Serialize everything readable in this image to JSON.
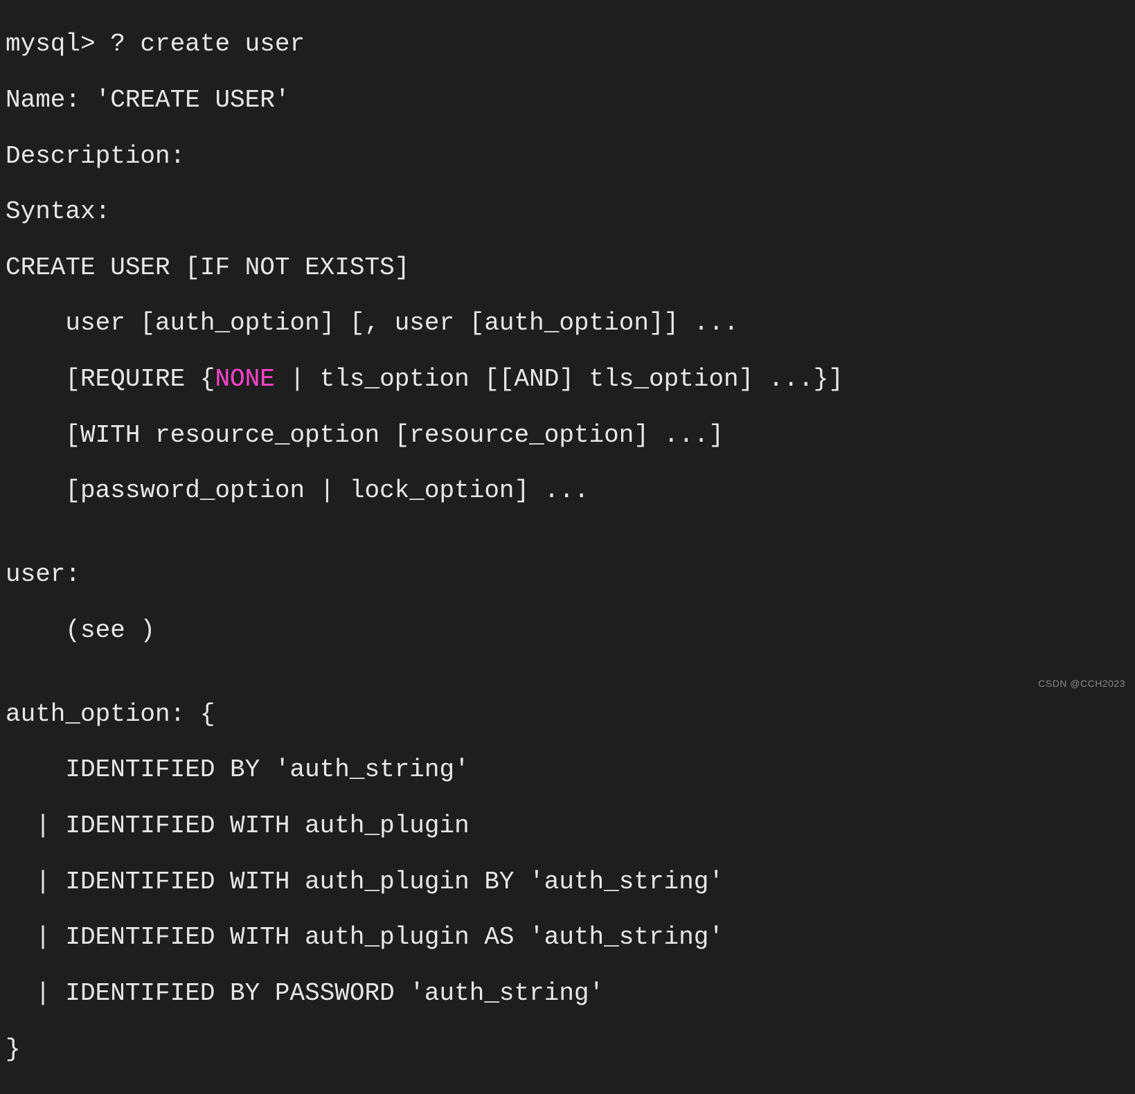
{
  "terminal": {
    "lines": [
      {
        "type": "plain",
        "text": "mysql> ? create user"
      },
      {
        "type": "plain",
        "text": "Name: 'CREATE USER'"
      },
      {
        "type": "plain",
        "text": "Description:"
      },
      {
        "type": "plain",
        "text": "Syntax:"
      },
      {
        "type": "plain",
        "text": "CREATE USER [IF NOT EXISTS]"
      },
      {
        "type": "plain",
        "text": "    user [auth_option] [, user [auth_option]] ..."
      },
      {
        "type": "highlight",
        "before": "    [REQUIRE {",
        "hl": "NONE",
        "after": " | tls_option [[AND] tls_option] ...}]"
      },
      {
        "type": "plain",
        "text": "    [WITH resource_option [resource_option] ...]"
      },
      {
        "type": "plain",
        "text": "    [password_option | lock_option] ..."
      },
      {
        "type": "plain",
        "text": ""
      },
      {
        "type": "plain",
        "text": "user:"
      },
      {
        "type": "plain",
        "text": "    (see )"
      },
      {
        "type": "plain",
        "text": ""
      },
      {
        "type": "plain",
        "text": "auth_option: {"
      },
      {
        "type": "plain",
        "text": "    IDENTIFIED BY 'auth_string'"
      },
      {
        "type": "plain",
        "text": "  | IDENTIFIED WITH auth_plugin"
      },
      {
        "type": "plain",
        "text": "  | IDENTIFIED WITH auth_plugin BY 'auth_string'"
      },
      {
        "type": "plain",
        "text": "  | IDENTIFIED WITH auth_plugin AS 'auth_string'"
      },
      {
        "type": "plain",
        "text": "  | IDENTIFIED BY PASSWORD 'auth_string'"
      },
      {
        "type": "plain",
        "text": "}"
      }
    ]
  },
  "watermark": "CSDN @CCH2023"
}
